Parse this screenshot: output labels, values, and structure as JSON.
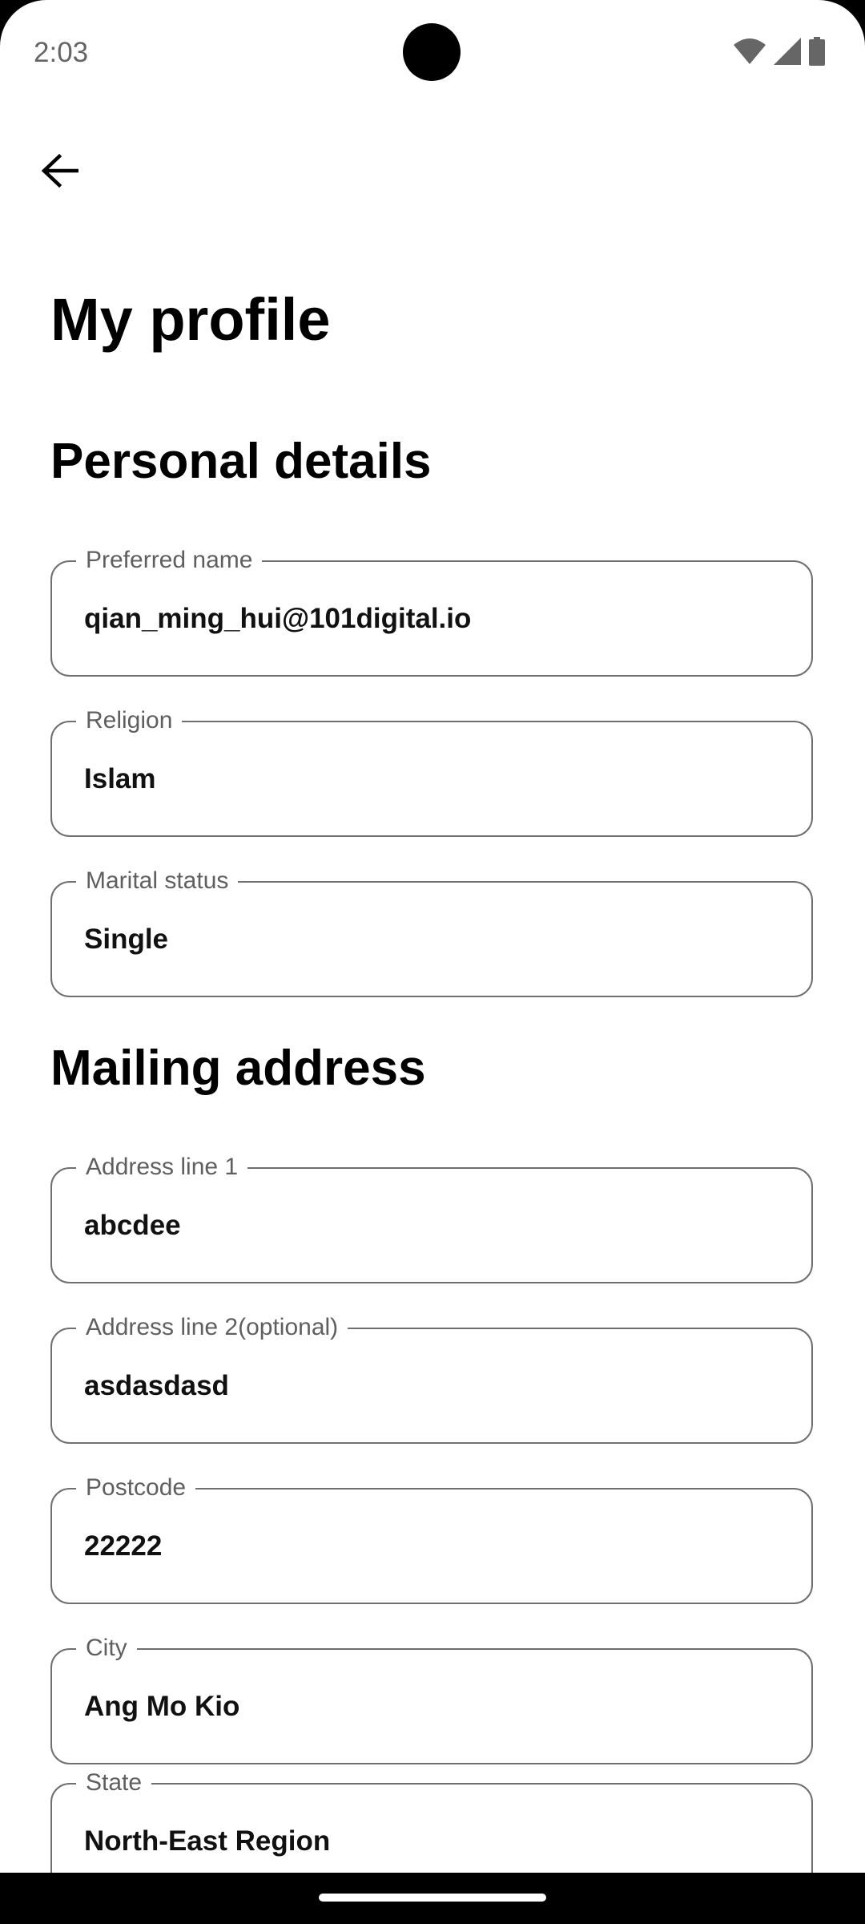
{
  "status_bar": {
    "time": "2:03",
    "icons": [
      "wifi-icon",
      "signal-icon",
      "battery-icon"
    ]
  },
  "header": {
    "back_icon": "arrow-left-icon",
    "title": "My profile"
  },
  "personal_details": {
    "title": "Personal details",
    "fields": [
      {
        "label": "Preferred name",
        "value": "qian_ming_hui@101digital.io"
      },
      {
        "label": "Religion",
        "value": "Islam"
      },
      {
        "label": "Marital status",
        "value": "Single"
      }
    ]
  },
  "mailing_address": {
    "title": "Mailing address",
    "fields": [
      {
        "label": "Address line 1",
        "value": "abcdee"
      },
      {
        "label": "Address line 2(optional)",
        "value": "asdasdasd"
      },
      {
        "label": "Postcode",
        "value": "22222"
      },
      {
        "label": "City",
        "value": "Ang Mo Kio"
      },
      {
        "label": "State",
        "value": "North-East Region"
      }
    ]
  },
  "colors": {
    "border": "#6f6f6f",
    "label": "#5f5f5f",
    "background": "#ffffff"
  }
}
